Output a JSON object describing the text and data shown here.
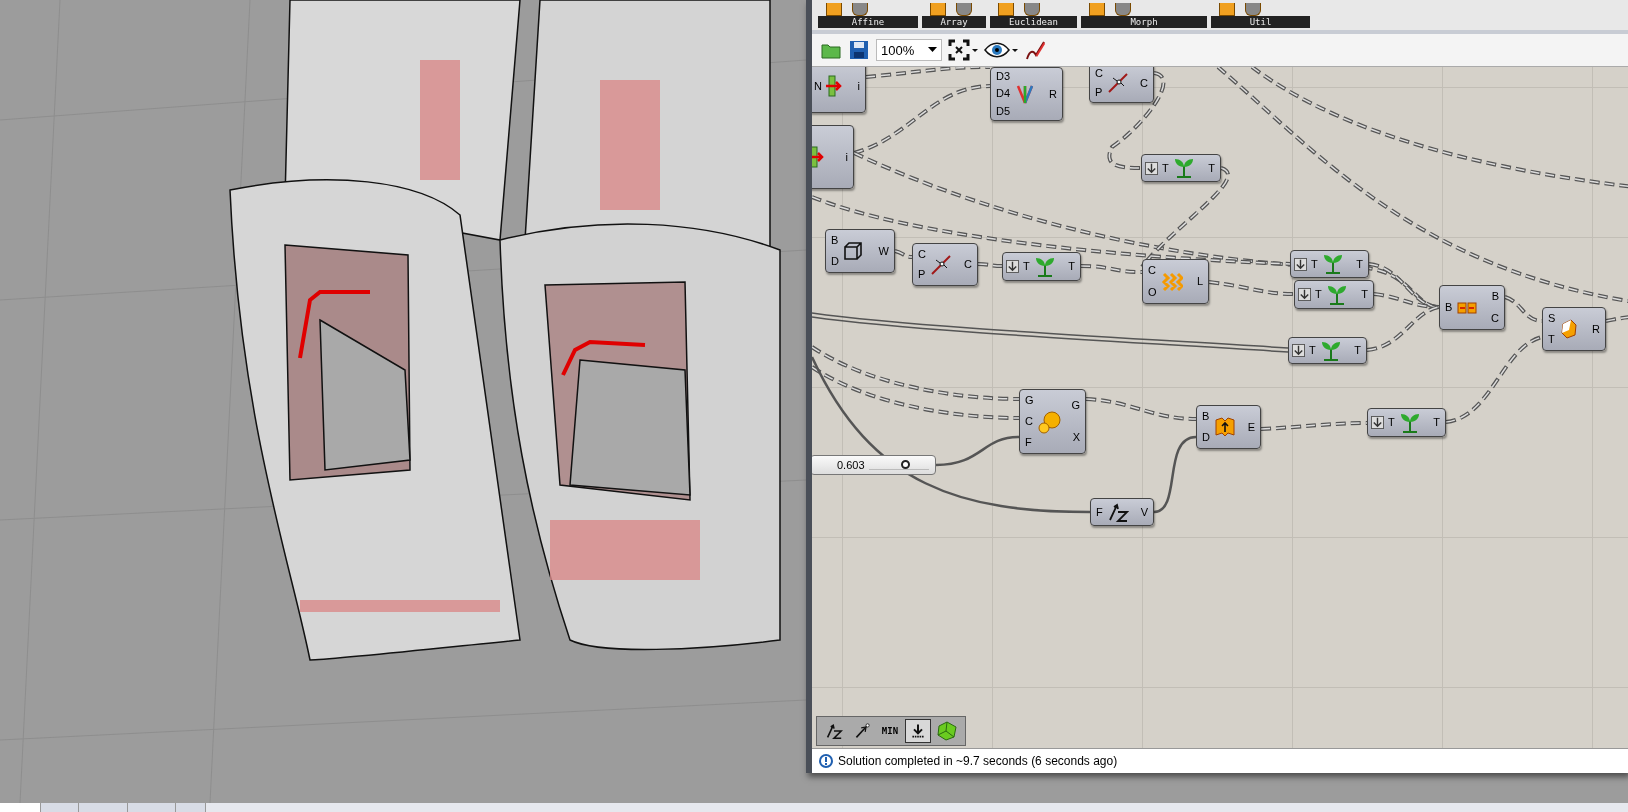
{
  "ribbon": {
    "groups": [
      {
        "label": "Affine"
      },
      {
        "label": "Array"
      },
      {
        "label": "Euclidean"
      },
      {
        "label": "Morph"
      },
      {
        "label": "Util"
      }
    ]
  },
  "toolbar": {
    "zoom": "100%"
  },
  "canvas": {
    "nodes": [
      {
        "kind": "param",
        "inputs": [
          "N"
        ],
        "outputs": [
          "i"
        ]
      },
      {
        "kind": "wave",
        "inputs": [
          "D3",
          "D4",
          "D5"
        ],
        "outputs": [
          "R"
        ]
      },
      {
        "kind": "closest",
        "inputs": [
          "C",
          "P"
        ],
        "outputs": [
          "C"
        ]
      },
      {
        "kind": "param",
        "outputs": [
          "i"
        ]
      },
      {
        "kind": "tree",
        "inputs": [
          "T"
        ],
        "outputs": [
          "T"
        ]
      },
      {
        "kind": "box",
        "inputs": [
          "B",
          "D"
        ],
        "outputs": [
          "W"
        ]
      },
      {
        "kind": "closest",
        "inputs": [
          "C",
          "P"
        ],
        "outputs": [
          "C"
        ]
      },
      {
        "kind": "tree",
        "inputs": [
          "T"
        ],
        "outputs": [
          "T"
        ]
      },
      {
        "kind": "offset",
        "inputs": [
          "C",
          "O"
        ],
        "outputs": [
          "L"
        ]
      },
      {
        "kind": "tree",
        "inputs": [
          "T"
        ],
        "outputs": [
          "T"
        ]
      },
      {
        "kind": "tree",
        "inputs": [
          "T"
        ],
        "outputs": [
          "T"
        ]
      },
      {
        "kind": "split",
        "inputs": [
          "B"
        ],
        "outputs": [
          "B",
          "C"
        ]
      },
      {
        "kind": "solid",
        "inputs": [
          "S",
          "T"
        ],
        "outputs": [
          "R"
        ]
      },
      {
        "kind": "tree",
        "inputs": [
          "T"
        ],
        "outputs": [
          "T"
        ]
      },
      {
        "kind": "spheres",
        "inputs": [
          "G",
          "C",
          "F"
        ],
        "outputs": [
          "G",
          "X"
        ]
      },
      {
        "kind": "extrude",
        "inputs": [
          "B",
          "D"
        ],
        "outputs": [
          "E"
        ]
      },
      {
        "kind": "tree",
        "inputs": [
          "T"
        ],
        "outputs": [
          "T"
        ]
      },
      {
        "kind": "zvector",
        "inputs": [
          "F"
        ],
        "outputs": [
          "V"
        ]
      }
    ],
    "slider": {
      "value": "0.603",
      "level": 0.6
    }
  },
  "mini_toolbar": [
    {
      "kind": "zvector",
      "selected": false
    },
    {
      "kind": "arrow",
      "selected": false
    },
    {
      "kind": "text",
      "label": "MIN",
      "selected": false
    },
    {
      "kind": "bake",
      "selected": true
    },
    {
      "kind": "gem",
      "selected": false
    }
  ],
  "status_bar": {
    "message": "Solution completed in ~9.7 seconds (6 seconds ago)"
  },
  "viewport_tabs": [
    {
      "selected": true
    },
    {
      "selected": false
    },
    {
      "selected": false
    },
    {
      "selected": false
    },
    {
      "selected": false
    }
  ]
}
